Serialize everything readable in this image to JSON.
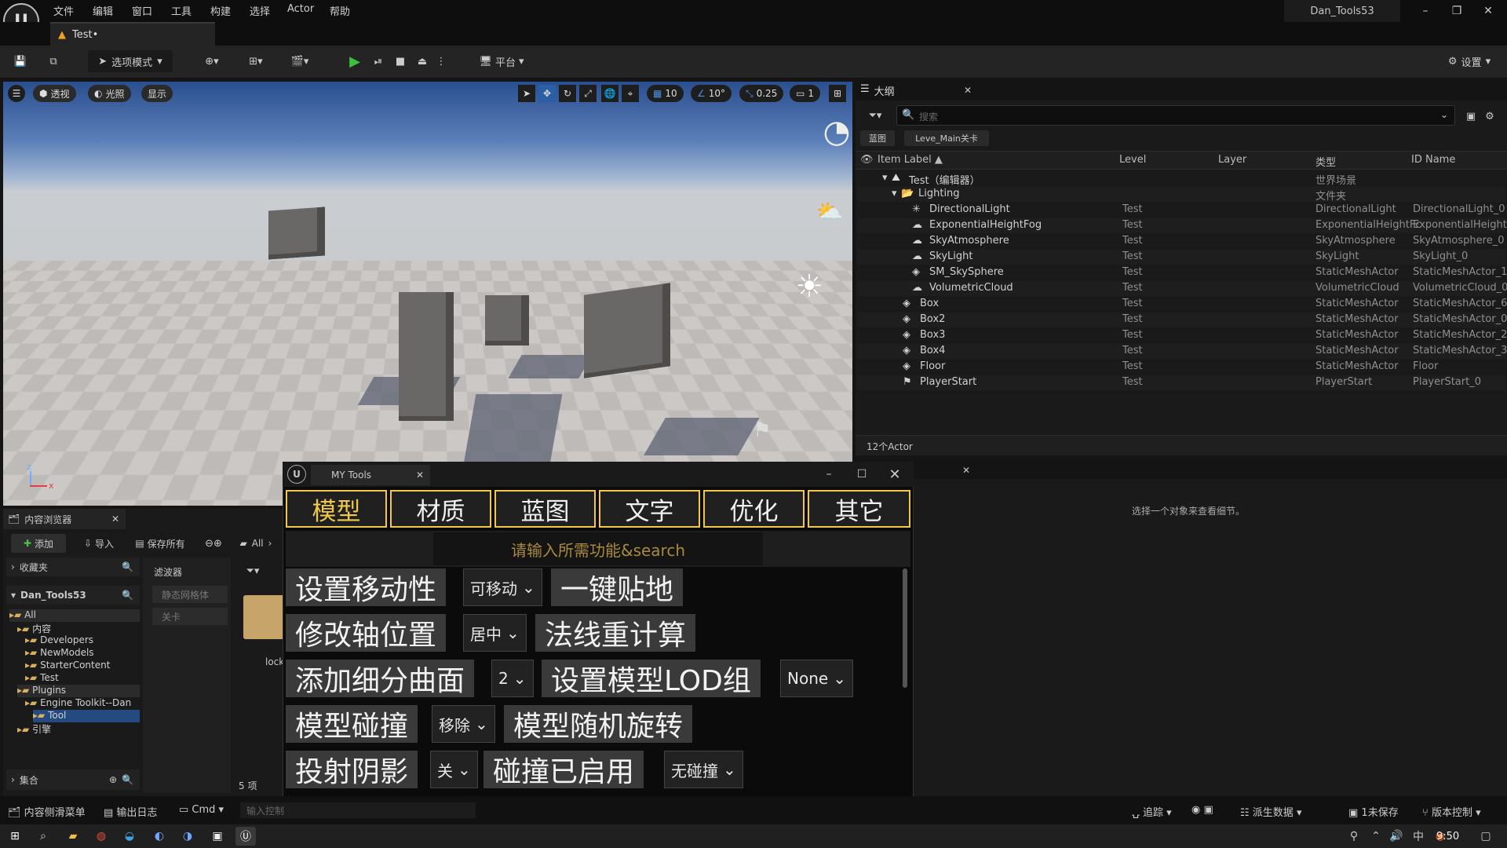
{
  "menubar": [
    "文件",
    "编辑",
    "窗口",
    "工具",
    "构建",
    "选择",
    "Actor",
    "帮助"
  ],
  "project_name": "Dan_Tools53",
  "doc_tab": "Test•",
  "toolbar": {
    "mode": "选项模式",
    "platform": "平台",
    "settings": "设置"
  },
  "viewport": {
    "perspective": "透视",
    "lighting": "光照",
    "show": "显示",
    "grid": "10",
    "angle": "10°",
    "scale": "0.25",
    "camera_speed": "1"
  },
  "outliner": {
    "title": "大纲",
    "search_placeholder": "搜索",
    "filter_blueprint": "蓝图",
    "filter_level": "Leve_Main关卡",
    "columns": [
      "Item Label ▲",
      "Level",
      "Layer",
      "类型",
      "ID Name"
    ],
    "rows": [
      {
        "label": "Test（编辑器）",
        "level": "",
        "type": "世界场景",
        "id": ""
      },
      {
        "label": "Lighting",
        "level": "",
        "type": "文件夹",
        "id": ""
      },
      {
        "label": "DirectionalLight",
        "level": "Test",
        "type": "DirectionalLight",
        "id": "DirectionalLight_0"
      },
      {
        "label": "ExponentialHeightFog",
        "level": "Test",
        "type": "ExponentialHeightFc",
        "id": "ExponentialHeightFc"
      },
      {
        "label": "SkyAtmosphere",
        "level": "Test",
        "type": "SkyAtmosphere",
        "id": "SkyAtmosphere_0"
      },
      {
        "label": "SkyLight",
        "level": "Test",
        "type": "SkyLight",
        "id": "SkyLight_0"
      },
      {
        "label": "SM_SkySphere",
        "level": "Test",
        "type": "StaticMeshActor",
        "id": "StaticMeshActor_1"
      },
      {
        "label": "VolumetricCloud",
        "level": "Test",
        "type": "VolumetricCloud",
        "id": "VolumetricCloud_0"
      },
      {
        "label": "Box",
        "level": "Test",
        "type": "StaticMeshActor",
        "id": "StaticMeshActor_6"
      },
      {
        "label": "Box2",
        "level": "Test",
        "type": "StaticMeshActor",
        "id": "StaticMeshActor_0"
      },
      {
        "label": "Box3",
        "level": "Test",
        "type": "StaticMeshActor",
        "id": "StaticMeshActor_2"
      },
      {
        "label": "Box4",
        "level": "Test",
        "type": "StaticMeshActor",
        "id": "StaticMeshActor_3"
      },
      {
        "label": "Floor",
        "level": "Test",
        "type": "StaticMeshActor",
        "id": "Floor"
      },
      {
        "label": "PlayerStart",
        "level": "Test",
        "type": "PlayerStart",
        "id": "PlayerStart_0"
      }
    ],
    "count": "12个Actor"
  },
  "details": {
    "empty_text": "选择一个对象来查看细节。"
  },
  "content_browser": {
    "title": "内容浏览器",
    "add": "添加",
    "import": "导入",
    "save_all": "保存所有",
    "path_all": "All",
    "favorites": "收藏夹",
    "project": "Dan_Tools53",
    "filters": "滤波器",
    "filter_items": [
      "静态网格体",
      "关卡"
    ],
    "tree": [
      "All",
      "内容",
      "Developers",
      "NewModels",
      "StarterContent",
      "Test",
      "Plugins",
      "Engine Toolkit--Dan",
      "Tool",
      "引擎"
    ],
    "collections": "集合",
    "item_count": "5 项",
    "asset_label": "lock"
  },
  "tools": {
    "title": "MY Tools",
    "categories": [
      "模型",
      "材质",
      "蓝图",
      "文字",
      "优化",
      "其它"
    ],
    "search_placeholder": "请输入所需功能&search",
    "actions": {
      "mobility": "设置移动性",
      "mobility_value": "可移动",
      "snap_ground": "一键贴地",
      "pivot": "修改轴位置",
      "pivot_value": "居中",
      "normals": "法线重计算",
      "subdiv": "添加细分曲面",
      "subdiv_value": "2",
      "lod_group": "设置模型LOD组",
      "lod_value": "None",
      "collision": "模型碰撞",
      "collision_value": "移除",
      "random_rot": "模型随机旋转",
      "cast_shadow": "投射阴影",
      "shadow_value": "关",
      "collision_enabled": "碰撞已启用",
      "collision_enabled_value": "无碰撞"
    }
  },
  "statusbar": {
    "drawer": "内容侧滑菜单",
    "output_log": "输出日志",
    "cmd": "Cmd",
    "console_placeholder": "输入控制",
    "trace": "追踪",
    "derived": "派生数据",
    "unsaved": "1未保存",
    "source_control": "版本控制"
  },
  "taskbar": {
    "time": "9:50"
  }
}
